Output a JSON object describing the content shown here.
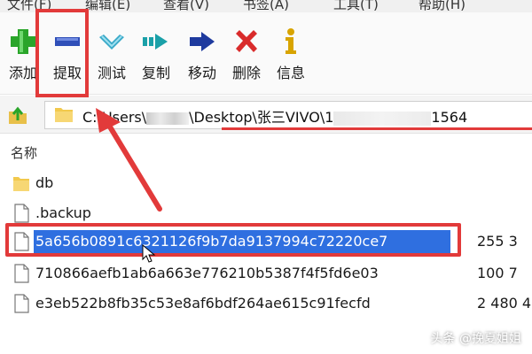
{
  "menubar": {
    "items": [
      "文件(F)",
      "编辑(E)",
      "查看(V)",
      "书签(A)",
      "工具(T)",
      "帮助(H)"
    ]
  },
  "toolbar": {
    "buttons": [
      {
        "label": "添加",
        "icon": "plus-icon",
        "color": "#2aa52a"
      },
      {
        "label": "提取",
        "icon": "minus-icon",
        "color": "#2f4fb8"
      },
      {
        "label": "测试",
        "icon": "check-icon",
        "color": "#3aa9c8"
      },
      {
        "label": "复制",
        "icon": "copy-arrow-icon",
        "color": "#1aa0a8"
      },
      {
        "label": "移动",
        "icon": "move-arrow-icon",
        "color": "#1e3a9e"
      },
      {
        "label": "删除",
        "icon": "delete-x-icon",
        "color": "#d92b2b"
      },
      {
        "label": "信息",
        "icon": "info-icon",
        "color": "#d8a400"
      }
    ]
  },
  "address": {
    "path_prefix": "C:\\Users\\",
    "path_middle": "\\Desktop\\张三VIVO\\1",
    "path_suffix": "1564"
  },
  "file_list": {
    "column_name": "名称",
    "items": [
      {
        "name": "db",
        "type": "folder",
        "size": ""
      },
      {
        "name": ".backup",
        "type": "file",
        "size": ""
      },
      {
        "name": "5a656b0891c6321126f9b7da9137994c72220ce7",
        "type": "file",
        "size": "255 3",
        "selected": true
      },
      {
        "name": "710866aefb1ab6a663e776210b5387f4f5fd6e03",
        "type": "file",
        "size": "100 7"
      },
      {
        "name": "e3eb522b8fb35c53e8af6bdf264ae615c91fecfd",
        "type": "file",
        "size": "2 480 4"
      }
    ]
  },
  "watermark": "头条 @挽夏姐姐",
  "colors": {
    "highlight_red": "#e23a3a",
    "selection_blue": "#2f6fe0"
  }
}
